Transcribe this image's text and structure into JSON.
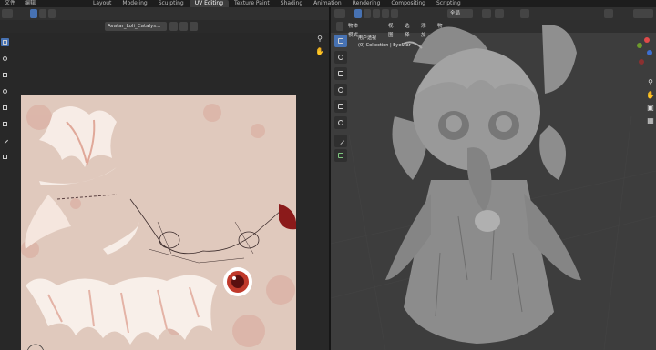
{
  "top_menu": {
    "file": "文件",
    "edit": "编辑"
  },
  "workspace_tabs": [
    {
      "label": "Layout"
    },
    {
      "label": "Modeling"
    },
    {
      "label": "Sculpting"
    },
    {
      "label": "UV Editing"
    },
    {
      "label": "Texture Paint"
    },
    {
      "label": "Shading"
    },
    {
      "label": "Animation"
    },
    {
      "label": "Rendering"
    },
    {
      "label": "Compositing"
    },
    {
      "label": "Scripting"
    }
  ],
  "uv_editor": {
    "image_name": "Avatar_Loli_Catalys...",
    "texture_bg": "#e0c9bd"
  },
  "viewport": {
    "mode": "物体模式",
    "menu": [
      "视图",
      "选择",
      "添加",
      "物体"
    ],
    "orientation": "全局",
    "view_name": "用户透视",
    "collection_info": "(0) Collection | EyeStar",
    "bg": "#3d3d3d"
  },
  "colors": {
    "accent": "#4772b3",
    "header": "#303030",
    "panel": "#282828"
  }
}
